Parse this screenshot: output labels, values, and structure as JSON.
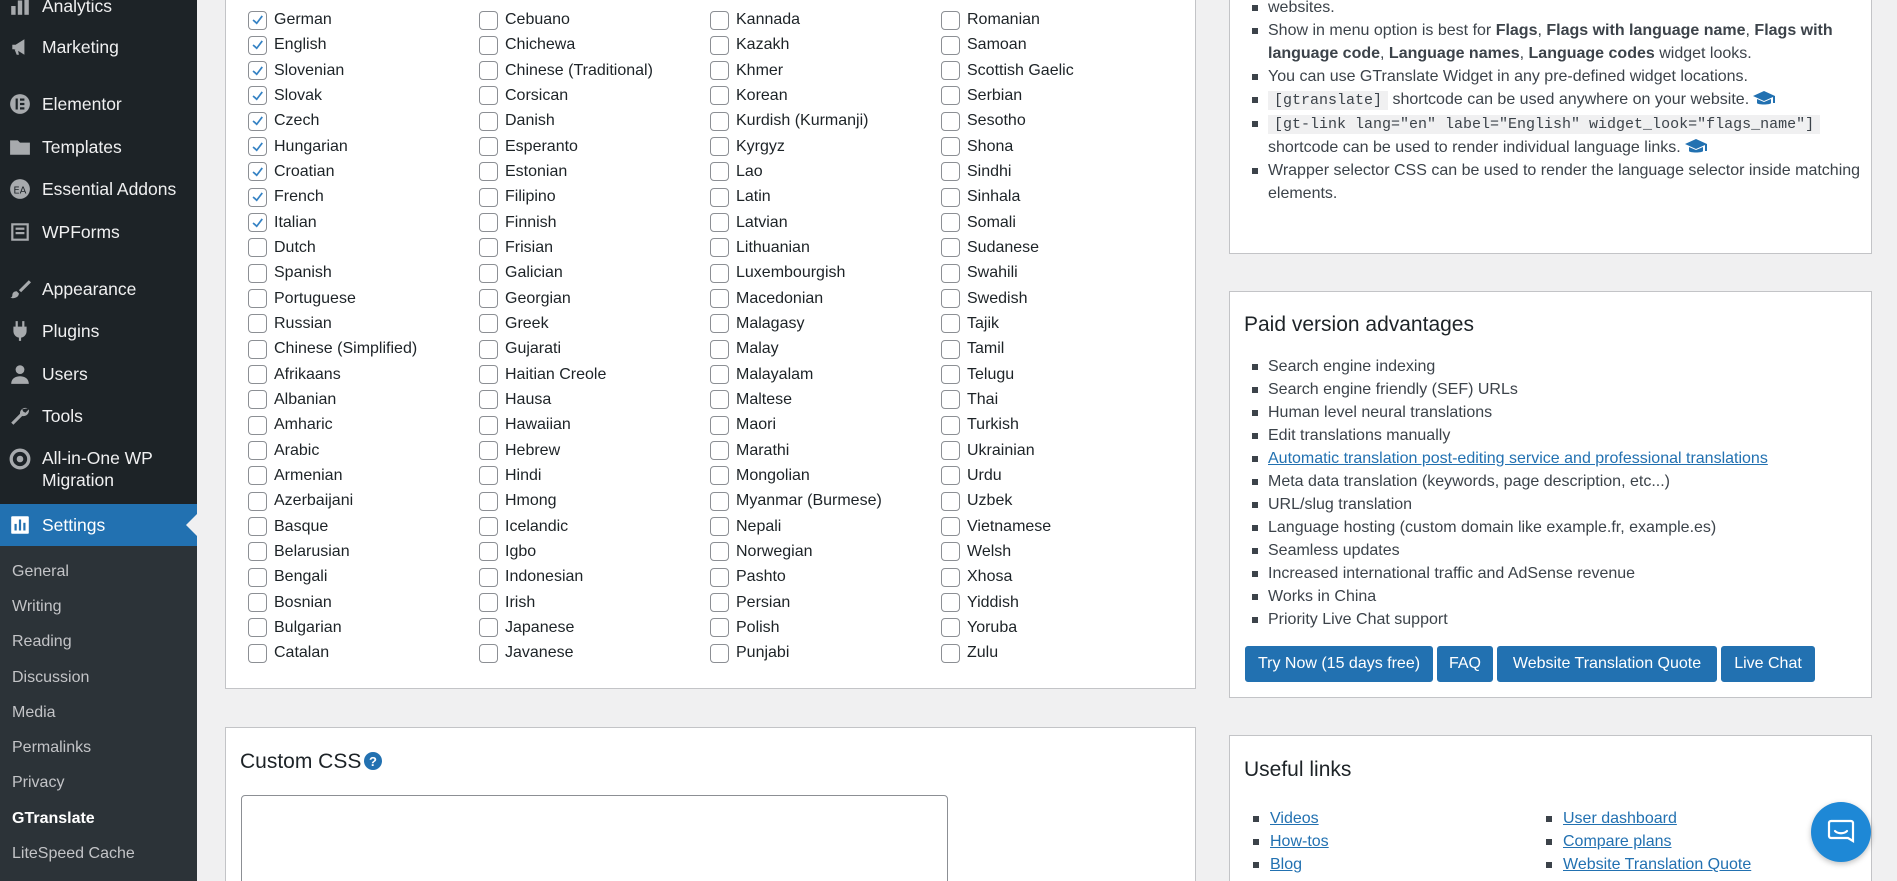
{
  "sidebar": {
    "items": [
      {
        "label": "Analytics",
        "icon": "chart-bar-icon"
      },
      {
        "label": "Marketing",
        "icon": "megaphone-icon"
      },
      {
        "label": "Elementor",
        "icon": "elementor-icon"
      },
      {
        "label": "Templates",
        "icon": "folder-icon"
      },
      {
        "label": "Essential Addons",
        "icon": "essential-addons-icon"
      },
      {
        "label": "WPForms",
        "icon": "form-icon"
      },
      {
        "label": "Appearance",
        "icon": "paintbrush-icon"
      },
      {
        "label": "Plugins",
        "icon": "plug-icon"
      },
      {
        "label": "Users",
        "icon": "user-icon"
      },
      {
        "label": "Tools",
        "icon": "wrench-icon"
      },
      {
        "label": "All-in-One WP",
        "label2": "Migration",
        "icon": "migration-icon"
      },
      {
        "label": "Settings",
        "icon": "settings-icon"
      }
    ],
    "submenu": [
      "General",
      "Writing",
      "Reading",
      "Discussion",
      "Media",
      "Permalinks",
      "Privacy",
      "GTranslate",
      "LiteSpeed Cache"
    ]
  },
  "languages": {
    "columns": [
      [
        {
          "name": "German",
          "checked": true
        },
        {
          "name": "English",
          "checked": true
        },
        {
          "name": "Slovenian",
          "checked": true
        },
        {
          "name": "Slovak",
          "checked": true
        },
        {
          "name": "Czech",
          "checked": true
        },
        {
          "name": "Hungarian",
          "checked": true
        },
        {
          "name": "Croatian",
          "checked": true
        },
        {
          "name": "French",
          "checked": true
        },
        {
          "name": "Italian",
          "checked": true
        },
        {
          "name": "Dutch",
          "checked": false
        },
        {
          "name": "Spanish",
          "checked": false
        },
        {
          "name": "Portuguese",
          "checked": false
        },
        {
          "name": "Russian",
          "checked": false
        },
        {
          "name": "Chinese (Simplified)",
          "checked": false
        },
        {
          "name": "Afrikaans",
          "checked": false
        },
        {
          "name": "Albanian",
          "checked": false
        },
        {
          "name": "Amharic",
          "checked": false
        },
        {
          "name": "Arabic",
          "checked": false
        },
        {
          "name": "Armenian",
          "checked": false
        },
        {
          "name": "Azerbaijani",
          "checked": false
        },
        {
          "name": "Basque",
          "checked": false
        },
        {
          "name": "Belarusian",
          "checked": false
        },
        {
          "name": "Bengali",
          "checked": false
        },
        {
          "name": "Bosnian",
          "checked": false
        },
        {
          "name": "Bulgarian",
          "checked": false
        },
        {
          "name": "Catalan",
          "checked": false
        }
      ],
      [
        {
          "name": "Cebuano",
          "checked": false
        },
        {
          "name": "Chichewa",
          "checked": false
        },
        {
          "name": "Chinese (Traditional)",
          "checked": false
        },
        {
          "name": "Corsican",
          "checked": false
        },
        {
          "name": "Danish",
          "checked": false
        },
        {
          "name": "Esperanto",
          "checked": false
        },
        {
          "name": "Estonian",
          "checked": false
        },
        {
          "name": "Filipino",
          "checked": false
        },
        {
          "name": "Finnish",
          "checked": false
        },
        {
          "name": "Frisian",
          "checked": false
        },
        {
          "name": "Galician",
          "checked": false
        },
        {
          "name": "Georgian",
          "checked": false
        },
        {
          "name": "Greek",
          "checked": false
        },
        {
          "name": "Gujarati",
          "checked": false
        },
        {
          "name": "Haitian Creole",
          "checked": false
        },
        {
          "name": "Hausa",
          "checked": false
        },
        {
          "name": "Hawaiian",
          "checked": false
        },
        {
          "name": "Hebrew",
          "checked": false
        },
        {
          "name": "Hindi",
          "checked": false
        },
        {
          "name": "Hmong",
          "checked": false
        },
        {
          "name": "Icelandic",
          "checked": false
        },
        {
          "name": "Igbo",
          "checked": false
        },
        {
          "name": "Indonesian",
          "checked": false
        },
        {
          "name": "Irish",
          "checked": false
        },
        {
          "name": "Japanese",
          "checked": false
        },
        {
          "name": "Javanese",
          "checked": false
        }
      ],
      [
        {
          "name": "Kannada",
          "checked": false
        },
        {
          "name": "Kazakh",
          "checked": false
        },
        {
          "name": "Khmer",
          "checked": false
        },
        {
          "name": "Korean",
          "checked": false
        },
        {
          "name": "Kurdish (Kurmanji)",
          "checked": false
        },
        {
          "name": "Kyrgyz",
          "checked": false
        },
        {
          "name": "Lao",
          "checked": false
        },
        {
          "name": "Latin",
          "checked": false
        },
        {
          "name": "Latvian",
          "checked": false
        },
        {
          "name": "Lithuanian",
          "checked": false
        },
        {
          "name": "Luxembourgish",
          "checked": false
        },
        {
          "name": "Macedonian",
          "checked": false
        },
        {
          "name": "Malagasy",
          "checked": false
        },
        {
          "name": "Malay",
          "checked": false
        },
        {
          "name": "Malayalam",
          "checked": false
        },
        {
          "name": "Maltese",
          "checked": false
        },
        {
          "name": "Maori",
          "checked": false
        },
        {
          "name": "Marathi",
          "checked": false
        },
        {
          "name": "Mongolian",
          "checked": false
        },
        {
          "name": "Myanmar (Burmese)",
          "checked": false
        },
        {
          "name": "Nepali",
          "checked": false
        },
        {
          "name": "Norwegian",
          "checked": false
        },
        {
          "name": "Pashto",
          "checked": false
        },
        {
          "name": "Persian",
          "checked": false
        },
        {
          "name": "Polish",
          "checked": false
        },
        {
          "name": "Punjabi",
          "checked": false
        }
      ],
      [
        {
          "name": "Romanian",
          "checked": false
        },
        {
          "name": "Samoan",
          "checked": false
        },
        {
          "name": "Scottish Gaelic",
          "checked": false
        },
        {
          "name": "Serbian",
          "checked": false
        },
        {
          "name": "Sesotho",
          "checked": false
        },
        {
          "name": "Shona",
          "checked": false
        },
        {
          "name": "Sindhi",
          "checked": false
        },
        {
          "name": "Sinhala",
          "checked": false
        },
        {
          "name": "Somali",
          "checked": false
        },
        {
          "name": "Sudanese",
          "checked": false
        },
        {
          "name": "Swahili",
          "checked": false
        },
        {
          "name": "Swedish",
          "checked": false
        },
        {
          "name": "Tajik",
          "checked": false
        },
        {
          "name": "Tamil",
          "checked": false
        },
        {
          "name": "Telugu",
          "checked": false
        },
        {
          "name": "Thai",
          "checked": false
        },
        {
          "name": "Turkish",
          "checked": false
        },
        {
          "name": "Ukrainian",
          "checked": false
        },
        {
          "name": "Urdu",
          "checked": false
        },
        {
          "name": "Uzbek",
          "checked": false
        },
        {
          "name": "Vietnamese",
          "checked": false
        },
        {
          "name": "Welsh",
          "checked": false
        },
        {
          "name": "Xhosa",
          "checked": false
        },
        {
          "name": "Yiddish",
          "checked": false
        },
        {
          "name": "Yoruba",
          "checked": false
        },
        {
          "name": "Zulu",
          "checked": false
        }
      ]
    ]
  },
  "custom_css": {
    "title": "Custom CSS",
    "help_icon": "question-circle-icon",
    "value": ""
  },
  "tips": {
    "line0": "websites.",
    "line1_a": "Show in menu option is best for ",
    "line1_b1": "Flags",
    "line1_c": ", ",
    "line1_b2": "Flags with language name",
    "line1_b3": "Flags with",
    "line1_b4": "language code",
    "line1_b5": "Language names",
    "line1_b6": "Language codes",
    "line1_d": " widget looks.",
    "line2": "You can use GTranslate Widget in any pre-defined widget locations.",
    "line3_code": "[gtranslate]",
    "line3_text": " shortcode can be used anywhere on your website.",
    "line4_code": "[gt-link lang=\"en\" label=\"English\" widget_look=\"flags_name\"]",
    "line4_text": "shortcode can be used to render individual language links.",
    "line5": "Wrapper selector CSS can be used to render the language selector inside matching elements."
  },
  "paid": {
    "title": "Paid version advantages",
    "items": [
      "Search engine indexing",
      "Search engine friendly (SEF) URLs",
      "Human level neural translations",
      "Edit translations manually",
      "Automatic translation post-editing service and professional translations",
      "Meta data translation (keywords, page description, etc...)",
      "URL/slug translation",
      "Language hosting (custom domain like example.fr, example.es)",
      "Seamless updates",
      "Increased international traffic and AdSense revenue",
      "Works in China",
      "Priority Live Chat support"
    ],
    "buttons": [
      "Try Now (15 days free)",
      "FAQ",
      "Website Translation Quote",
      "Live Chat"
    ]
  },
  "useful": {
    "title": "Useful links",
    "left": [
      "Videos",
      "How-tos",
      "Blog"
    ],
    "right": [
      "User dashboard",
      "Compare plans",
      "Website Translation Quote"
    ]
  },
  "colors": {
    "accent": "#2271b1",
    "sidebar_bg": "#1d2327",
    "submenu_bg": "#2c3338",
    "chat_bubble": "#1e88d6"
  }
}
